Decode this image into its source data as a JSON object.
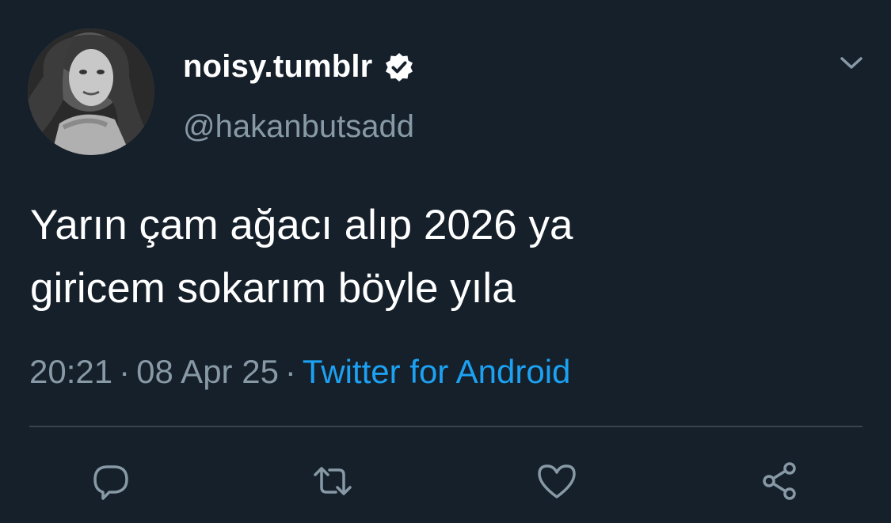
{
  "colors": {
    "background": "#15202b",
    "text_primary": "#ffffff",
    "text_secondary": "#8899a6",
    "link": "#1da1f2",
    "divider": "#38444d"
  },
  "author": {
    "display_name": "noisy.tumblr",
    "handle": "@hakanbutsadd",
    "verified": true,
    "avatar_icon": "profile-photo"
  },
  "tweet": {
    "line1": "Yarın çam ağacı alıp 2026 ya",
    "line2": "giricem sokarım böyle yıla"
  },
  "meta": {
    "time": "20:21",
    "date": "08 Apr 25",
    "separator": "·",
    "source": "Twitter for Android"
  },
  "actions": [
    {
      "name": "reply",
      "icon": "reply-icon"
    },
    {
      "name": "retweet",
      "icon": "retweet-icon"
    },
    {
      "name": "like",
      "icon": "heart-icon"
    },
    {
      "name": "share",
      "icon": "share-icon"
    }
  ],
  "menu": {
    "icon": "chevron-down-icon"
  }
}
